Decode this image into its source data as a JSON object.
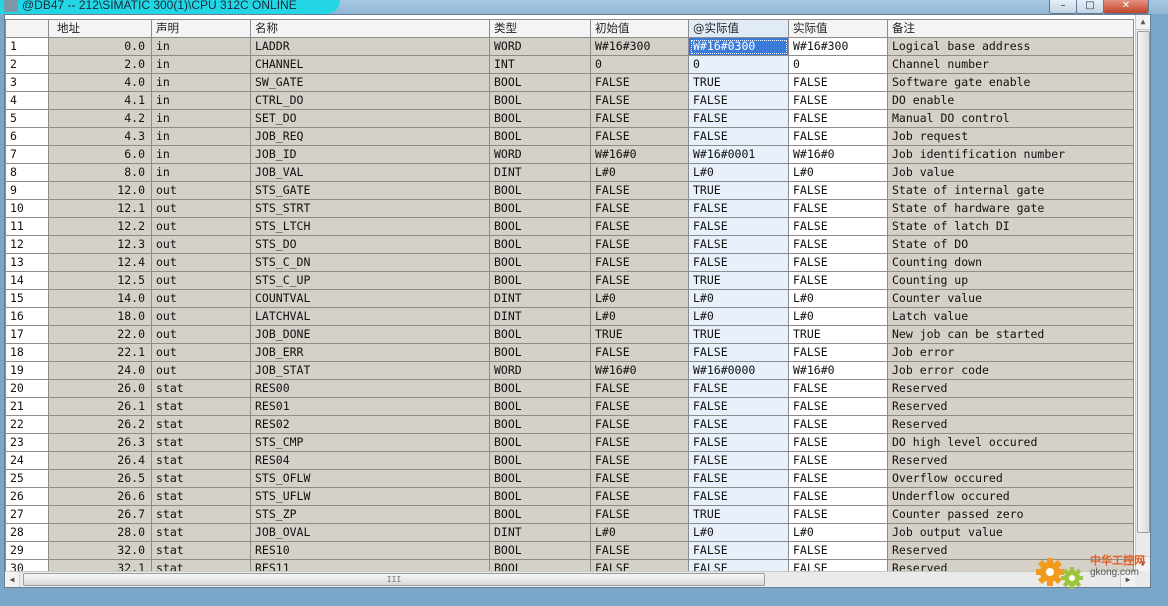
{
  "window": {
    "title": "@DB47 -- 212\\SIMATIC 300(1)\\CPU 312C  ONLINE",
    "min_glyph": "–",
    "max_glyph": "□",
    "close_glyph": "✕"
  },
  "columns": {
    "address": "地址",
    "declaration": "声明",
    "name": "名称",
    "type": "类型",
    "initial": "初始值",
    "online_actual": "@实际值",
    "actual": "实际值",
    "comment": "备注"
  },
  "rows": [
    {
      "n": "1",
      "addr": "0.0",
      "decl": "in",
      "name": "LADDR",
      "type": "WORD",
      "init": "W#16#300",
      "online": "W#16#0300",
      "actual": "W#16#300",
      "comment": "Logical base address"
    },
    {
      "n": "2",
      "addr": "2.0",
      "decl": "in",
      "name": "CHANNEL",
      "type": "INT",
      "init": "0",
      "online": "0",
      "actual": "0",
      "comment": "Channel number"
    },
    {
      "n": "3",
      "addr": "4.0",
      "decl": "in",
      "name": "SW_GATE",
      "type": "BOOL",
      "init": "FALSE",
      "online": "TRUE",
      "actual": "FALSE",
      "comment": "Software gate enable"
    },
    {
      "n": "4",
      "addr": "4.1",
      "decl": "in",
      "name": "CTRL_DO",
      "type": "BOOL",
      "init": "FALSE",
      "online": "FALSE",
      "actual": "FALSE",
      "comment": "DO enable"
    },
    {
      "n": "5",
      "addr": "4.2",
      "decl": "in",
      "name": "SET_DO",
      "type": "BOOL",
      "init": "FALSE",
      "online": "FALSE",
      "actual": "FALSE",
      "comment": "Manual DO control"
    },
    {
      "n": "6",
      "addr": "4.3",
      "decl": "in",
      "name": "JOB_REQ",
      "type": "BOOL",
      "init": "FALSE",
      "online": "FALSE",
      "actual": "FALSE",
      "comment": "Job request"
    },
    {
      "n": "7",
      "addr": "6.0",
      "decl": "in",
      "name": "JOB_ID",
      "type": "WORD",
      "init": "W#16#0",
      "online": "W#16#0001",
      "actual": "W#16#0",
      "comment": "Job identification number"
    },
    {
      "n": "8",
      "addr": "8.0",
      "decl": "in",
      "name": "JOB_VAL",
      "type": "DINT",
      "init": "L#0",
      "online": "L#0",
      "actual": "L#0",
      "comment": "Job value"
    },
    {
      "n": "9",
      "addr": "12.0",
      "decl": "out",
      "name": "STS_GATE",
      "type": "BOOL",
      "init": "FALSE",
      "online": "TRUE",
      "actual": "FALSE",
      "comment": "State of internal gate"
    },
    {
      "n": "10",
      "addr": "12.1",
      "decl": "out",
      "name": "STS_STRT",
      "type": "BOOL",
      "init": "FALSE",
      "online": "FALSE",
      "actual": "FALSE",
      "comment": "State of hardware gate"
    },
    {
      "n": "11",
      "addr": "12.2",
      "decl": "out",
      "name": "STS_LTCH",
      "type": "BOOL",
      "init": "FALSE",
      "online": "FALSE",
      "actual": "FALSE",
      "comment": "State of latch DI"
    },
    {
      "n": "12",
      "addr": "12.3",
      "decl": "out",
      "name": "STS_DO",
      "type": "BOOL",
      "init": "FALSE",
      "online": "FALSE",
      "actual": "FALSE",
      "comment": "State of DO"
    },
    {
      "n": "13",
      "addr": "12.4",
      "decl": "out",
      "name": "STS_C_DN",
      "type": "BOOL",
      "init": "FALSE",
      "online": "FALSE",
      "actual": "FALSE",
      "comment": "Counting down"
    },
    {
      "n": "14",
      "addr": "12.5",
      "decl": "out",
      "name": "STS_C_UP",
      "type": "BOOL",
      "init": "FALSE",
      "online": "TRUE",
      "actual": "FALSE",
      "comment": "Counting up"
    },
    {
      "n": "15",
      "addr": "14.0",
      "decl": "out",
      "name": "COUNTVAL",
      "type": "DINT",
      "init": "L#0",
      "online": "L#0",
      "actual": "L#0",
      "comment": "Counter value"
    },
    {
      "n": "16",
      "addr": "18.0",
      "decl": "out",
      "name": "LATCHVAL",
      "type": "DINT",
      "init": "L#0",
      "online": "L#0",
      "actual": "L#0",
      "comment": "Latch value"
    },
    {
      "n": "17",
      "addr": "22.0",
      "decl": "out",
      "name": "JOB_DONE",
      "type": "BOOL",
      "init": "TRUE",
      "online": "TRUE",
      "actual": "TRUE",
      "comment": "New job can be started"
    },
    {
      "n": "18",
      "addr": "22.1",
      "decl": "out",
      "name": "JOB_ERR",
      "type": "BOOL",
      "init": "FALSE",
      "online": "FALSE",
      "actual": "FALSE",
      "comment": "Job error"
    },
    {
      "n": "19",
      "addr": "24.0",
      "decl": "out",
      "name": "JOB_STAT",
      "type": "WORD",
      "init": "W#16#0",
      "online": "W#16#0000",
      "actual": "W#16#0",
      "comment": "Job error code"
    },
    {
      "n": "20",
      "addr": "26.0",
      "decl": "stat",
      "name": "RES00",
      "type": "BOOL",
      "init": "FALSE",
      "online": "FALSE",
      "actual": "FALSE",
      "comment": "Reserved"
    },
    {
      "n": "21",
      "addr": "26.1",
      "decl": "stat",
      "name": "RES01",
      "type": "BOOL",
      "init": "FALSE",
      "online": "FALSE",
      "actual": "FALSE",
      "comment": "Reserved"
    },
    {
      "n": "22",
      "addr": "26.2",
      "decl": "stat",
      "name": "RES02",
      "type": "BOOL",
      "init": "FALSE",
      "online": "FALSE",
      "actual": "FALSE",
      "comment": "Reserved"
    },
    {
      "n": "23",
      "addr": "26.3",
      "decl": "stat",
      "name": "STS_CMP",
      "type": "BOOL",
      "init": "FALSE",
      "online": "FALSE",
      "actual": "FALSE",
      "comment": "DO high level occured"
    },
    {
      "n": "24",
      "addr": "26.4",
      "decl": "stat",
      "name": "RES04",
      "type": "BOOL",
      "init": "FALSE",
      "online": "FALSE",
      "actual": "FALSE",
      "comment": "Reserved"
    },
    {
      "n": "25",
      "addr": "26.5",
      "decl": "stat",
      "name": "STS_OFLW",
      "type": "BOOL",
      "init": "FALSE",
      "online": "FALSE",
      "actual": "FALSE",
      "comment": "Overflow occured"
    },
    {
      "n": "26",
      "addr": "26.6",
      "decl": "stat",
      "name": "STS_UFLW",
      "type": "BOOL",
      "init": "FALSE",
      "online": "FALSE",
      "actual": "FALSE",
      "comment": "Underflow occured"
    },
    {
      "n": "27",
      "addr": "26.7",
      "decl": "stat",
      "name": "STS_ZP",
      "type": "BOOL",
      "init": "FALSE",
      "online": "TRUE",
      "actual": "FALSE",
      "comment": "Counter passed zero"
    },
    {
      "n": "28",
      "addr": "28.0",
      "decl": "stat",
      "name": "JOB_OVAL",
      "type": "DINT",
      "init": "L#0",
      "online": "L#0",
      "actual": "L#0",
      "comment": "Job output value"
    },
    {
      "n": "29",
      "addr": "32.0",
      "decl": "stat",
      "name": "RES10",
      "type": "BOOL",
      "init": "FALSE",
      "online": "FALSE",
      "actual": "FALSE",
      "comment": "Reserved"
    },
    {
      "n": "30",
      "addr": "32.1",
      "decl": "stat",
      "name": "RES11",
      "type": "BOOL",
      "init": "FALSE",
      "online": "FALSE",
      "actual": "FALSE",
      "comment": "Reserved"
    }
  ],
  "selected_row": 0,
  "scrollbar": {
    "h_thumb_grip": "III",
    "up_arrow": "▲",
    "down_arrow": "▼",
    "left_arrow": "◀",
    "right_arrow": "▶"
  },
  "watermark": {
    "brand_cn": "中华工控网",
    "domain": "gkong.com"
  },
  "colors": {
    "title_tab": "#22d6e6",
    "cell_gray": "#d5d0c8",
    "online_col": "#e8f0fb",
    "selection": "#3a7ad8"
  }
}
